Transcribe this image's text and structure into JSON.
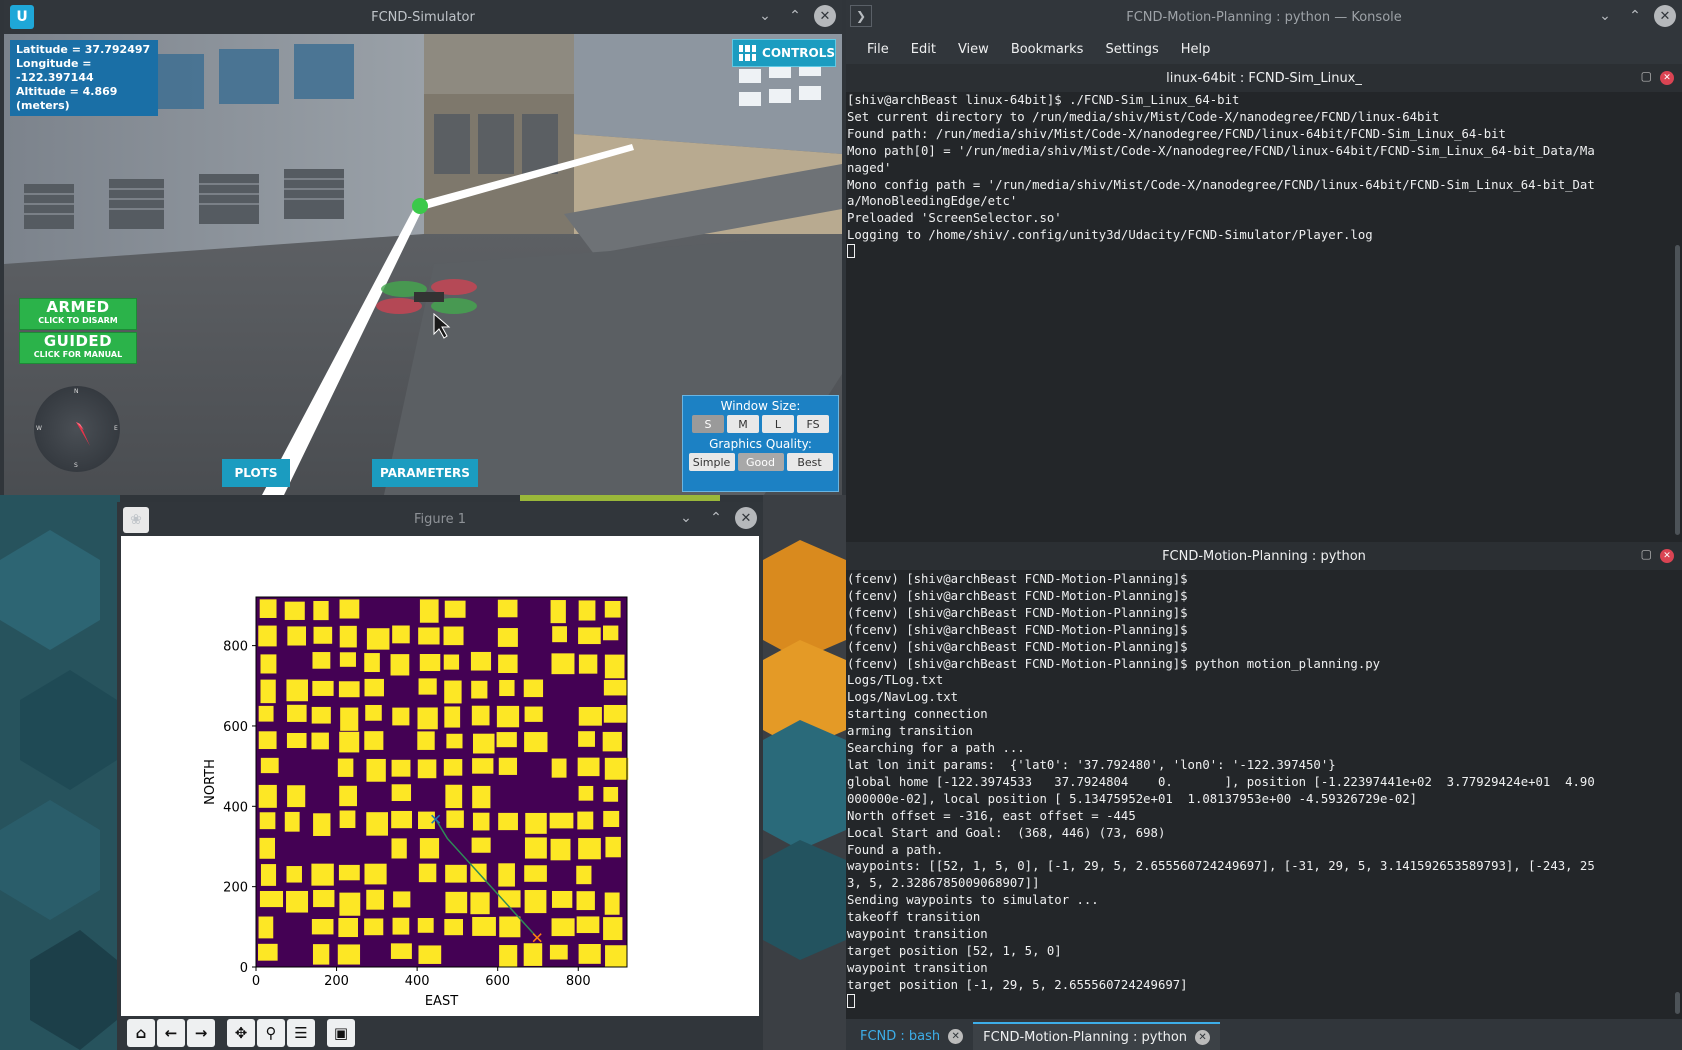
{
  "simulator": {
    "title": "FCND-Simulator",
    "latitude": "Latitude = 37.792497",
    "longitude": "Longitude = -122.397144",
    "altitude": "Altitude = 4.869 (meters)",
    "controls_label": "CONTROLS",
    "armed": {
      "big": "ARMED",
      "small": "CLICK TO DISARM"
    },
    "guided": {
      "big": "GUIDED",
      "small": "CLICK FOR MANUAL"
    },
    "compass": {
      "n": "N",
      "s": "S",
      "e": "E",
      "w": "W"
    },
    "plots_label": "PLOTS",
    "parameters_label": "PARAMETERS",
    "window_size_label": "Window Size:",
    "sizes": [
      "S",
      "M",
      "L",
      "FS"
    ],
    "selected_size": "S",
    "graphics_quality_label": "Graphics Quality:",
    "qualities": [
      "Simple",
      "Good",
      "Best"
    ],
    "selected_quality": "Good"
  },
  "figure": {
    "title": "Figure 1",
    "toolbar": [
      "home-icon",
      "back-icon",
      "forward-icon",
      "pan-icon",
      "zoom-icon",
      "configure-icon",
      "save-icon"
    ]
  },
  "chart_data": {
    "type": "heatmap",
    "title": "",
    "xlabel": "EAST",
    "ylabel": "NORTH",
    "xlim": [
      0,
      921
    ],
    "ylim": [
      0,
      921
    ],
    "xticks": [
      0,
      200,
      400,
      600,
      800
    ],
    "yticks": [
      0,
      200,
      400,
      600,
      800
    ],
    "colormap": {
      "free": "#440154",
      "obstacle": "#fde725"
    },
    "path": {
      "color": "#2e8b57",
      "points": [
        [
          446,
          368
        ],
        [
          475,
          320
        ],
        [
          698,
          73
        ]
      ]
    },
    "start": {
      "east": 446,
      "north": 368,
      "marker": "x",
      "color": "#1f77b4"
    },
    "goal": {
      "east": 698,
      "north": 73,
      "marker": "x",
      "color": "#ff7f0e"
    }
  },
  "konsole": {
    "title": "FCND-Motion-Planning : python — Konsole",
    "menu": [
      "File",
      "Edit",
      "View",
      "Bookmarks",
      "Settings",
      "Help"
    ],
    "top_pane_title": "linux-64bit : FCND-Sim_Linux_",
    "top_lines": [
      "[shiv@archBeast linux-64bit]$ ./FCND-Sim_Linux_64-bit",
      "Set current directory to /run/media/shiv/Mist/Code-X/nanodegree/FCND/linux-64bit",
      "Found path: /run/media/shiv/Mist/Code-X/nanodegree/FCND/linux-64bit/FCND-Sim_Linux_64-bit",
      "Mono path[0] = '/run/media/shiv/Mist/Code-X/nanodegree/FCND/linux-64bit/FCND-Sim_Linux_64-bit_Data/Ma",
      "naged'",
      "Mono config path = '/run/media/shiv/Mist/Code-X/nanodegree/FCND/linux-64bit/FCND-Sim_Linux_64-bit_Dat",
      "a/MonoBleedingEdge/etc'",
      "Preloaded 'ScreenSelector.so'",
      "Logging to /home/shiv/.config/unity3d/Udacity/FCND-Simulator/Player.log"
    ],
    "bottom_pane_title": "FCND-Motion-Planning : python",
    "bottom_lines": [
      "(fcenv) [shiv@archBeast FCND-Motion-Planning]$",
      "(fcenv) [shiv@archBeast FCND-Motion-Planning]$",
      "(fcenv) [shiv@archBeast FCND-Motion-Planning]$",
      "(fcenv) [shiv@archBeast FCND-Motion-Planning]$",
      "(fcenv) [shiv@archBeast FCND-Motion-Planning]$",
      "(fcenv) [shiv@archBeast FCND-Motion-Planning]$ python motion_planning.py",
      "Logs/TLog.txt",
      "Logs/NavLog.txt",
      "starting connection",
      "arming transition",
      "Searching for a path ...",
      "lat lon init params:  {'lat0': '37.792480', 'lon0': '-122.397450'}",
      "global home [-122.3974533   37.7924804    0.       ], position [-1.22397441e+02  3.77929424e+01  4.90",
      "000000e-02], local position [ 5.13475952e+01  1.08137953e+00 -4.59326729e-02]",
      "North offset = -316, east offset = -445",
      "Local Start and Goal:  (368, 446) (73, 698)",
      "Found a path.",
      "waypoints: [[52, 1, 5, 0], [-1, 29, 5, 2.655560724249697], [-31, 29, 5, 3.141592653589793], [-243, 25",
      "3, 5, 2.3286785009068907]]",
      "Sending waypoints to simulator ...",
      "takeoff transition",
      "waypoint transition",
      "target position [52, 1, 5, 0]",
      "waypoint transition",
      "target position [-1, 29, 5, 2.655560724249697]"
    ],
    "tabs": [
      {
        "label": "FCND : bash",
        "active": false
      },
      {
        "label": "FCND-Motion-Planning : python",
        "active": true
      }
    ]
  }
}
